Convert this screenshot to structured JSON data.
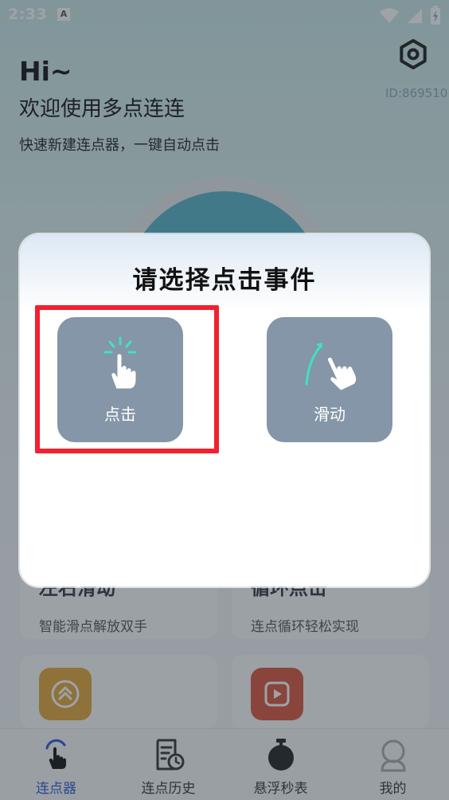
{
  "status_bar": {
    "time": "2:33",
    "notification_badge": "A"
  },
  "header": {
    "user_id": "ID:869510",
    "greeting": "Hi~",
    "welcome": "欢迎使用多点连连",
    "subtitle": "快速新建连点器，一键自动点击"
  },
  "cards": [
    {
      "title": "左右滑动",
      "desc": "智能滑点解放双手",
      "icon_color": "#e3a53a"
    },
    {
      "title": "循环点击",
      "desc": "连点循环轻松实现",
      "icon_color": "#d9553d"
    }
  ],
  "dialog": {
    "title": "请选择点击事件",
    "options": [
      {
        "label": "点击",
        "icon": "tap-finger-icon",
        "selected": true
      },
      {
        "label": "滑动",
        "icon": "swipe-finger-icon",
        "selected": false
      }
    ],
    "highlight_color": "#f4202f"
  },
  "tabbar": {
    "items": [
      {
        "label": "连点器",
        "icon": "tap-hand-icon",
        "active": true
      },
      {
        "label": "连点历史",
        "icon": "history-icon",
        "active": false
      },
      {
        "label": "悬浮秒表",
        "icon": "stopwatch-icon",
        "active": false
      },
      {
        "label": "我的",
        "icon": "profile-icon",
        "active": false
      }
    ],
    "active_color": "#2d57d3"
  }
}
